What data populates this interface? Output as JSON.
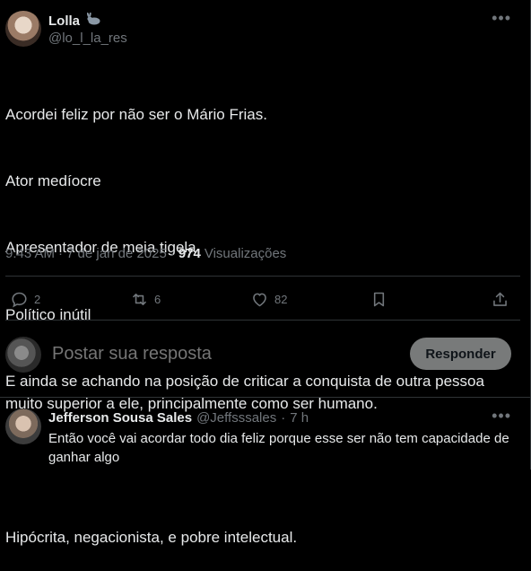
{
  "tweet": {
    "author_name": "Lolla",
    "author_badge_icon": "rabbit-icon",
    "handle": "@lo_l_la_res",
    "lines": [
      "Acordei feliz por não ser o Mário Frias.",
      "Ator medíocre",
      "Apresentador de meia tigela",
      "Político inútil",
      "E ainda se achando na posição de criticar a conquista de outra pessoa muito superior a ele, principalmente como ser humano.",
      "",
      "Hipócrita, negacionista, e pobre intelectual."
    ],
    "time": "9:43 AM",
    "date": "7 de jan de 2025",
    "views_count": "974",
    "views_label": "Visualizações"
  },
  "actions": {
    "replies": "2",
    "retweets": "6",
    "likes": "82"
  },
  "composer": {
    "placeholder": "Postar sua resposta",
    "button_label": "Responder"
  },
  "comment": {
    "name": "Jefferson Sousa Sales",
    "handle": "@Jeffsssales",
    "dot": "·",
    "time": "7 h",
    "text": "Então você vai acordar todo dia feliz porque esse ser não tem capacidade de ganhar algo"
  },
  "colors": {
    "background": "#000000",
    "text": "#e7e9ea",
    "muted": "#71767b",
    "border": "#2f3336",
    "reply_button": "#787a7a"
  }
}
